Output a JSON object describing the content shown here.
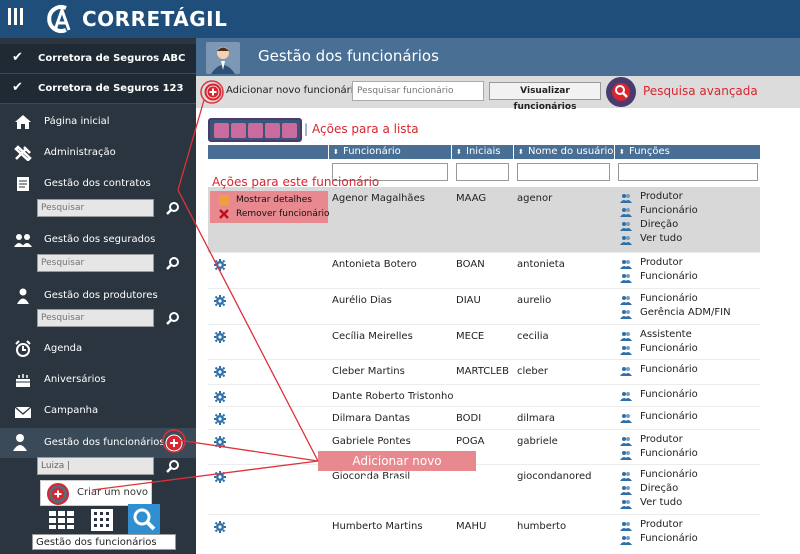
{
  "app": {
    "brand": "CORRETÁGIL"
  },
  "sidebar": {
    "companies": [
      {
        "label": "Corretora de Seguros ABC"
      },
      {
        "label": "Corretora de Seguros 123"
      }
    ],
    "items": [
      {
        "label": "Página inicial",
        "icon": "home-icon"
      },
      {
        "label": "Administração",
        "icon": "tools-icon"
      },
      {
        "label": "Gestão dos contratos",
        "icon": "contract-icon"
      },
      {
        "label": "Gestão dos segurados",
        "icon": "people-icon"
      },
      {
        "label": "Gestão dos produtores",
        "icon": "producer-icon"
      },
      {
        "label": "Agenda",
        "icon": "alarm-clock-icon"
      },
      {
        "label": "Aniversários",
        "icon": "cake-icon"
      },
      {
        "label": "Campanha",
        "icon": "mail-icon"
      },
      {
        "label": "Gestão dos funcionários",
        "icon": "employee-icon"
      }
    ],
    "search_placeholder": "Pesquisar",
    "employee_search_value": "Luiza |",
    "create_new_label": "Criar um novo",
    "bottom_search_value": "Gestão dos funcionários"
  },
  "header": {
    "title": "Gestão dos funcionários"
  },
  "toolbar": {
    "add_label": "Adicionar novo funcionário",
    "search_placeholder": "Pesquisar funcionário",
    "view_button": "Visualizar funcionários",
    "advanced_search": "Pesquisa avançada"
  },
  "list_actions": {
    "separator": "|",
    "label": "Ações para a lista"
  },
  "table": {
    "columns": [
      "Funcionário",
      "Iniciais",
      "Nome do usuário",
      "Funções"
    ],
    "row_actions_title": "Ações para este funcionário",
    "row_actions": [
      "Mostrar detalhes",
      "Remover funcionário"
    ],
    "rows": [
      {
        "name": "Agenor Magalhães",
        "initials": "MAAG",
        "user": "agenor",
        "roles": [
          "Produtor",
          "Funcionário",
          "Direção",
          "Ver tudo"
        ]
      },
      {
        "name": "Antonieta Botero",
        "initials": "BOAN",
        "user": "antonieta",
        "roles": [
          "Produtor",
          "Funcionário"
        ]
      },
      {
        "name": "Aurélio Dias",
        "initials": "DIAU",
        "user": "aurelio",
        "roles": [
          "Funcionário",
          "Gerência ADM/FIN"
        ]
      },
      {
        "name": "Cecília Meirelles",
        "initials": "MECE",
        "user": "cecilia",
        "roles": [
          "Assistente",
          "Funcionário"
        ]
      },
      {
        "name": "Cleber Martins",
        "initials": "MARTCLEB",
        "user": "cleber",
        "roles": [
          "Funcionário"
        ]
      },
      {
        "name": "Dante Roberto Tristonho",
        "initials": "",
        "user": "",
        "roles": [
          "Funcionário"
        ]
      },
      {
        "name": "Dilmara Dantas",
        "initials": "BODI",
        "user": "dilmara",
        "roles": [
          "Funcionário"
        ]
      },
      {
        "name": "Gabriele Pontes",
        "initials": "POGA",
        "user": "gabriele",
        "roles": [
          "Produtor",
          "Funcionário"
        ]
      },
      {
        "name": "Gioconda Brasil",
        "initials": "",
        "user": "giocondanored",
        "roles": [
          "Funcionário",
          "Direção",
          "Ver tudo"
        ]
      },
      {
        "name": "Humberto Martins",
        "initials": "MAHU",
        "user": "humberto",
        "roles": [
          "Produtor",
          "Funcionário"
        ]
      }
    ]
  },
  "callouts": {
    "add_new": "Adicionar novo funcionário"
  },
  "colors": {
    "accent_red": "#d8252f",
    "header_blue": "#4a6f95",
    "sidebar_dark": "#2a3540",
    "topbar": "#1f4e7a"
  }
}
